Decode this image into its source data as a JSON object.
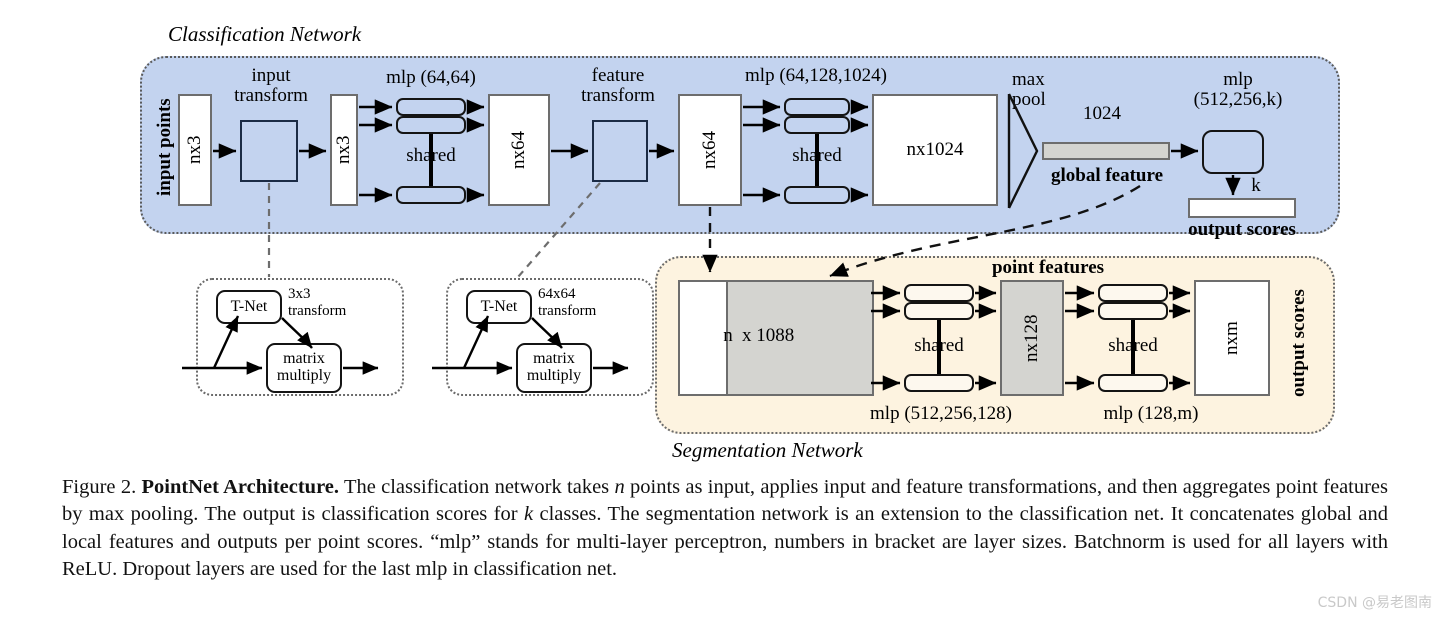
{
  "figure": {
    "classification_network_title": "Classification Network",
    "segmentation_network_title": "Segmentation Network"
  },
  "classification": {
    "input_points_label": "input points",
    "input_box_label": "nx3",
    "input_transform_label": "input\ntransform",
    "input_transform_line1": "input",
    "input_transform_line2": "transform",
    "after_transform_label": "nx3",
    "mlp1_label": "mlp (64,64)",
    "shared1_label": "shared",
    "nx64_a_label": "nx64",
    "feature_transform_line1": "feature",
    "feature_transform_line2": "transform",
    "nx64_b_label": "nx64",
    "mlp2_label": "mlp (64,128,1024)",
    "shared2_label": "shared",
    "nx1024_label": "nx1024",
    "maxpool_line1": "max",
    "maxpool_line2": "pool",
    "global_feature_size": "1024",
    "global_feature_label": "global feature",
    "mlp3_line1": "mlp",
    "mlp3_line2": "(512,256,k)",
    "k_label": "k",
    "output_scores_label": "output scores"
  },
  "tnet_input": {
    "tnet_label": "T-Net",
    "transform_line1": "3x3",
    "transform_line2": "transform",
    "matrix_line1": "matrix",
    "matrix_line2": "multiply"
  },
  "tnet_feature": {
    "tnet_label": "T-Net",
    "transform_line1": "64x64",
    "transform_line2": "transform",
    "matrix_line1": "matrix",
    "matrix_line2": "multiply"
  },
  "segmentation": {
    "point_features_label": "point features",
    "concat_n_label": "n",
    "concat_dim_label": "x 1088",
    "mlp1_label": "mlp (512,256,128)",
    "shared1_label": "shared",
    "nx128_label": "nx128",
    "mlp2_label": "mlp (128,m)",
    "shared2_label": "shared",
    "nxm_label": "nxm",
    "output_scores_label": "output scores"
  },
  "caption": {
    "figure_number": "Figure 2.",
    "bold_title": "PointNet Architecture.",
    "seg1": " The classification network takes ",
    "it_n1": "n",
    "seg2": " points as input, applies input and feature transformations, and then aggregates point features by max pooling. The output is classification scores for ",
    "it_k": "k",
    "seg3": " classes. The segmentation network is an extension to the classification net. It concatenates global and local features and outputs per point scores. “mlp” stands for multi-layer perceptron, numbers in bracket are layer sizes. Batchnorm is used for all layers with ReLU. Dropout layers are used for the last mlp in classification net."
  },
  "watermark": {
    "text": "CSDN @易老图南"
  },
  "colors": {
    "classification_panel": "#c3d3ef",
    "segmentation_panel": "#fdf3e0",
    "global_feature_bar": "#d4d4d0",
    "box_border": "#6d6d6d",
    "dark_border": "#141414"
  }
}
